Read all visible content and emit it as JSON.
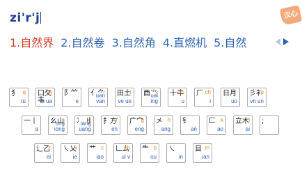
{
  "composition": {
    "text": "zi'r'j"
  },
  "skin_logo": {
    "text": "汉心"
  },
  "candidates": [
    {
      "label": "1.自然界"
    },
    {
      "label": "2.自然卷"
    },
    {
      "label": "3.自然角"
    },
    {
      "label": "4.直燃机"
    },
    {
      "label": "5.自然"
    }
  ],
  "pager": {
    "prev_icon": "triangle-left-icon",
    "next_icon": "triangle-right-icon"
  },
  "keyboard": {
    "row1": [
      {
        "glyph": "犭",
        "sup": "q",
        "vowel": "iu"
      },
      {
        "glyph": "口攵丰",
        "sup": "w",
        "vowel": "ia ua"
      },
      {
        "glyph": "阝⺮",
        "sup": "",
        "vowel": "e"
      },
      {
        "glyph": "亻⺈",
        "sup": "r",
        "vowel": "uan van"
      },
      {
        "glyph": "田土",
        "sup": "t",
        "vowel": "ve ue"
      },
      {
        "glyph": "酉⺌",
        "sup": "y",
        "vowel": "uai ing"
      },
      {
        "glyph": "十㐄",
        "sup": "sh",
        "vowel": "u"
      },
      {
        "glyph": "厂",
        "sup": "ch",
        "vowel": "i"
      },
      {
        "glyph": "日月",
        "sup": "",
        "vowel": "uo"
      },
      {
        "glyph": "彡衤",
        "sup": "p",
        "vowel": "vn un"
      }
    ],
    "row2": [
      {
        "glyph": "一丨",
        "sup": "",
        "vowel": "a"
      },
      {
        "glyph": "幺山",
        "sup": "s",
        "vowel": "ong iong"
      },
      {
        "glyph": "冫刂",
        "sup": "d",
        "vowel": "iang uang"
      },
      {
        "glyph": "扌方",
        "sup": "f",
        "vowel": "en"
      },
      {
        "glyph": "广宀",
        "sup": "g",
        "vowel": "eng"
      },
      {
        "glyph": "㐅",
        "sup": "h",
        "vowel": "ang"
      },
      {
        "glyph": "钅",
        "sup": "",
        "vowel": "an"
      },
      {
        "glyph": "匚",
        "sup": "k",
        "vowel": "ao"
      },
      {
        "glyph": "立木",
        "sup": "l",
        "vowel": "ai"
      },
      {
        "glyph": ";",
        "sup": "",
        "vowel": ""
      }
    ],
    "row3": [
      {
        "glyph": "辶乙",
        "sup": "z",
        "vowel": "ei"
      },
      {
        "glyph": "㇏乂",
        "sup": "x",
        "vowel": "ie"
      },
      {
        "glyph": "艹",
        "sup": "c",
        "vowel": "iao"
      },
      {
        "glyph": "𠃊ム",
        "sup": "zh",
        "vowel": "ui v"
      },
      {
        "glyph": "⺧",
        "sup": "b",
        "vowel": "ou"
      },
      {
        "glyph": "㇏",
        "sup": "",
        "vowel": "in"
      },
      {
        "glyph": "目",
        "sup": "m",
        "vowel": "ian"
      }
    ]
  }
}
